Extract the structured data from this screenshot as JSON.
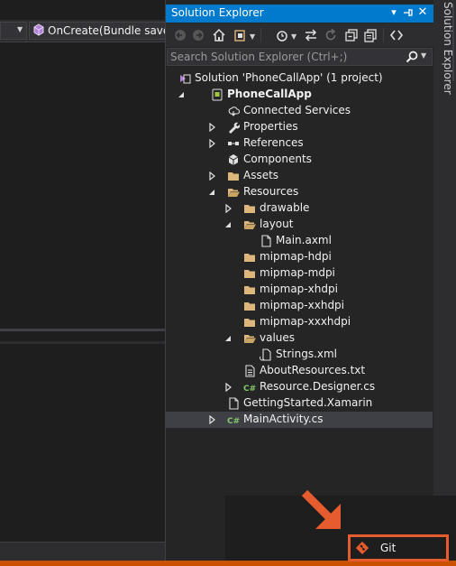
{
  "editor": {
    "method_dropdown_label": "OnCreate(Bundle savedI"
  },
  "solution_explorer": {
    "title": "Solution Explorer",
    "search_placeholder": "Search Solution Explorer (Ctrl+;)",
    "toolbar_icons": [
      "back-icon",
      "forward-icon",
      "home-icon",
      "switch-views-icon",
      "pending-changes-filter-icon",
      "sync-active-document-icon",
      "refresh-icon",
      "collapse-all-icon",
      "show-all-files-icon",
      "properties-icon",
      "preview-icon"
    ],
    "tree": [
      {
        "label": "Solution 'PhoneCallApp' (1 project)",
        "icon": "solution-icon",
        "chevron": "none",
        "depth": 0,
        "bold": false
      },
      {
        "label": "PhoneCallApp",
        "icon": "android-project-icon",
        "chevron": "expanded",
        "depth": 0,
        "bold": true
      },
      {
        "label": "Connected Services",
        "icon": "connected-services-icon",
        "chevron": "none",
        "depth": 1,
        "bold": false
      },
      {
        "label": "Properties",
        "icon": "wrench-icon",
        "chevron": "collapsed",
        "depth": 1,
        "bold": false
      },
      {
        "label": "References",
        "icon": "references-icon",
        "chevron": "collapsed",
        "depth": 1,
        "bold": false
      },
      {
        "label": "Components",
        "icon": "components-icon",
        "chevron": "none",
        "depth": 1,
        "bold": false
      },
      {
        "label": "Assets",
        "icon": "folder-icon",
        "chevron": "collapsed",
        "depth": 1,
        "bold": false
      },
      {
        "label": "Resources",
        "icon": "folder-open-icon",
        "chevron": "expanded",
        "depth": 1,
        "bold": false
      },
      {
        "label": "drawable",
        "icon": "folder-icon",
        "chevron": "collapsed",
        "depth": 2,
        "bold": false
      },
      {
        "label": "layout",
        "icon": "folder-open-icon",
        "chevron": "expanded",
        "depth": 2,
        "bold": false
      },
      {
        "label": "Main.axml",
        "icon": "file-icon",
        "chevron": "none",
        "depth": 3,
        "bold": false
      },
      {
        "label": "mipmap-hdpi",
        "icon": "folder-icon",
        "chevron": "none",
        "depth": 2,
        "bold": false
      },
      {
        "label": "mipmap-mdpi",
        "icon": "folder-icon",
        "chevron": "none",
        "depth": 2,
        "bold": false
      },
      {
        "label": "mipmap-xhdpi",
        "icon": "folder-icon",
        "chevron": "none",
        "depth": 2,
        "bold": false
      },
      {
        "label": "mipmap-xxhdpi",
        "icon": "folder-icon",
        "chevron": "none",
        "depth": 2,
        "bold": false
      },
      {
        "label": "mipmap-xxxhdpi",
        "icon": "folder-icon",
        "chevron": "none",
        "depth": 2,
        "bold": false
      },
      {
        "label": "values",
        "icon": "folder-open-icon",
        "chevron": "expanded",
        "depth": 2,
        "bold": false
      },
      {
        "label": "Strings.xml",
        "icon": "xml-file-icon",
        "chevron": "none",
        "depth": 3,
        "bold": false
      },
      {
        "label": "AboutResources.txt",
        "icon": "text-file-icon",
        "chevron": "none",
        "depth": 2,
        "bold": false
      },
      {
        "label": "Resource.Designer.cs",
        "icon": "csharp-file-icon",
        "chevron": "collapsed",
        "depth": 2,
        "bold": false
      },
      {
        "label": "GettingStarted.Xamarin",
        "icon": "file-icon",
        "chevron": "none",
        "depth": 1,
        "bold": false
      },
      {
        "label": "MainActivity.cs",
        "icon": "csharp-file-icon",
        "chevron": "collapsed",
        "depth": 1,
        "bold": false,
        "selected": true
      }
    ]
  },
  "side_tab": {
    "label": "Solution Explorer"
  },
  "status": {
    "git_label": "Git"
  },
  "colors": {
    "title_blue": "#007acc",
    "status_orange": "#ca5100",
    "highlight_orange": "#e65c2e",
    "csharp_green": "#83c56b",
    "folder_yellow": "#dcb67a",
    "android_green": "#a4c639"
  }
}
